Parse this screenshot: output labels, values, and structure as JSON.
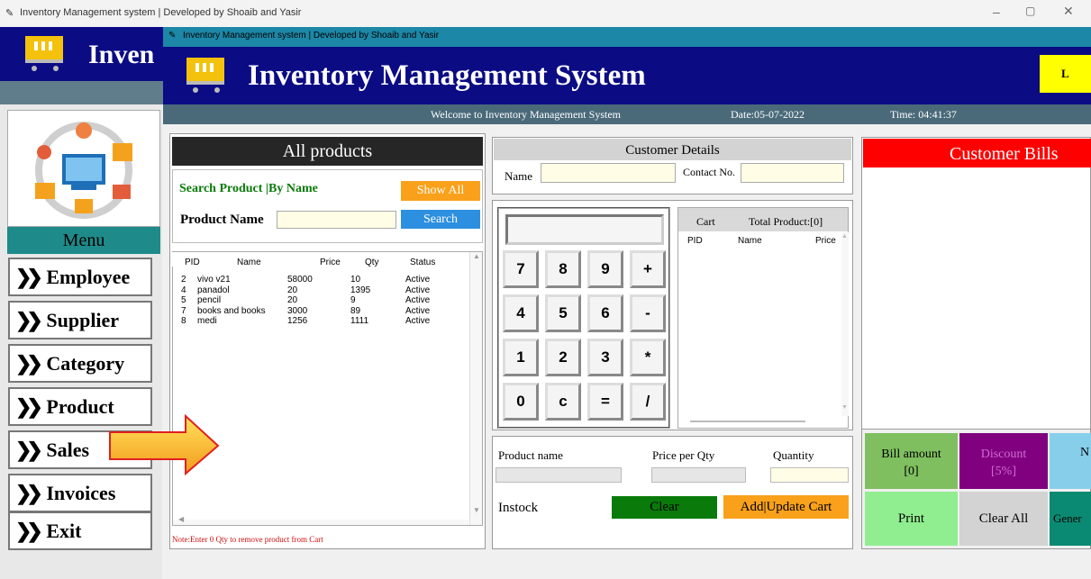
{
  "outer_window": {
    "title": "Inventory Management system | Developed by Shoaib and Yasir",
    "brand_partial": "Inven"
  },
  "inner_window": {
    "title": "Inventory Management system | Developed by Shoaib and Yasir",
    "heading": "Inventory Management System",
    "logout_partial": "L"
  },
  "status_bar": {
    "welcome": "Welcome to Inventory Management System",
    "date": "Date:05-07-2022",
    "time": "Time: 04:41:37"
  },
  "menu": {
    "title": "Menu",
    "items": [
      {
        "label": "Employee"
      },
      {
        "label": "Supplier"
      },
      {
        "label": "Category"
      },
      {
        "label": "Product"
      },
      {
        "label": "Sales"
      },
      {
        "label": "Invoices"
      },
      {
        "label": "Exit"
      }
    ]
  },
  "products": {
    "title": "All products",
    "search_title": "Search Product |By Name",
    "show_all": "Show All",
    "product_name_label": "Product Name",
    "product_name_value": "",
    "search_button": "Search",
    "columns": [
      "PID",
      "Name",
      "Price",
      "Qty",
      "Status"
    ],
    "rows": [
      [
        "2",
        "vivo v21",
        "58000",
        "10",
        "Active"
      ],
      [
        "4",
        "panadol",
        "20",
        "1395",
        "Active"
      ],
      [
        "5",
        "pencil",
        "20",
        "9",
        "Active"
      ],
      [
        "7",
        "books and books",
        "3000",
        "89",
        "Active"
      ],
      [
        "8",
        "medi",
        "1256",
        "1111",
        "Active"
      ]
    ],
    "note": "Note:Enter 0 Qty to remove product from Cart"
  },
  "customer": {
    "title": "Customer Details",
    "name_label": "Name",
    "name_value": "",
    "contact_label": "Contact No.",
    "contact_value": ""
  },
  "calculator": {
    "display": "",
    "keys": [
      "7",
      "8",
      "9",
      "+",
      "4",
      "5",
      "6",
      "-",
      "1",
      "2",
      "3",
      "*",
      "0",
      "c",
      "=",
      "/"
    ]
  },
  "cart": {
    "title": "Cart",
    "total": "Total Product:[0]",
    "columns": [
      "PID",
      "Name",
      "Price"
    ]
  },
  "product_entry": {
    "name_label": "Product name",
    "price_label": "Price per Qty",
    "qty_label": "Quantity",
    "instock_label": "Instock",
    "clear": "Clear",
    "add_update": "Add|Update Cart"
  },
  "bills": {
    "title": "Customer Bills",
    "bill_amount": "Bill amount",
    "bill_amount_value": "[0]",
    "discount": "Discount",
    "discount_value": "[5%]",
    "net_partial": "N",
    "print": "Print",
    "clear_all": "Clear All",
    "generate_partial": "Gener"
  },
  "colors": {
    "navy": "#0b0b84",
    "teal": "#1f6f8b",
    "red": "#ff0000",
    "orange": "#f9a11b",
    "blue": "#2d8fdf",
    "green": "#0a7a0a",
    "bill_green": "#7fbf5f",
    "discount_purple": "#800080",
    "net_blue": "#87ceeb",
    "print_green": "#90ee90",
    "yellow": "#ffff00"
  }
}
